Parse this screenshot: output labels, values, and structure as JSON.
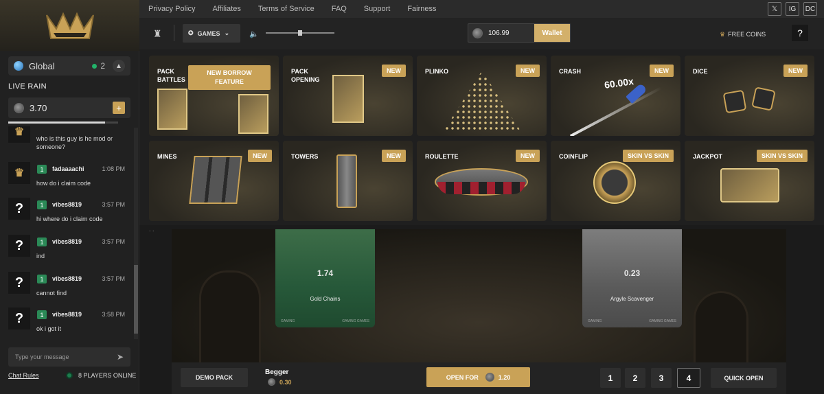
{
  "nav": {
    "links": [
      "Privacy Policy",
      "Affiliates",
      "Terms of Service",
      "FAQ",
      "Support",
      "Fairness"
    ],
    "social": [
      "𝕏",
      "IG",
      "DC"
    ]
  },
  "sidebar": {
    "room": {
      "name": "Global",
      "online_count": "2"
    },
    "live_rain": {
      "label": "LIVE RAIN",
      "amount": "3.70",
      "plus": "+"
    },
    "messages": [
      {
        "level": "",
        "user": "",
        "time": "",
        "text": "who is this guy is he mod or someone?",
        "avatar": "crown"
      },
      {
        "level": "1",
        "user": "fadaaaachi",
        "time": "1:08 PM",
        "text": "how do i claim code",
        "avatar": "crown"
      },
      {
        "level": "1",
        "user": "vibes8819",
        "time": "3:57 PM",
        "text": "hi where do i claim code",
        "avatar": "?"
      },
      {
        "level": "1",
        "user": "vibes8819",
        "time": "3:57 PM",
        "text": "ind",
        "avatar": "?"
      },
      {
        "level": "1",
        "user": "vibes8819",
        "time": "3:57 PM",
        "text": "cannot find",
        "avatar": "?"
      },
      {
        "level": "1",
        "user": "vibes8819",
        "time": "3:58 PM",
        "text": "ok i got it",
        "avatar": "?"
      }
    ],
    "input_placeholder": "Type your message",
    "chat_rules": "Chat Rules",
    "players_online": "8 PLAYERS ONLINE"
  },
  "toolbar": {
    "games_label": "GAMES",
    "balance": "106.99",
    "wallet_label": "Wallet",
    "free_coins": "FREE COINS",
    "help": "?",
    "volume_level": 0.5
  },
  "games": [
    {
      "name": "PACK BATTLES",
      "badge": "NEW BORROW FEATURE"
    },
    {
      "name": "PACK OPENING",
      "badge": "NEW"
    },
    {
      "name": "PLINKO",
      "badge": "NEW"
    },
    {
      "name": "CRASH",
      "badge": "NEW",
      "extra": "60.00x"
    },
    {
      "name": "DICE",
      "badge": "NEW"
    },
    {
      "name": "MINES",
      "badge": "NEW"
    },
    {
      "name": "TOWERS",
      "badge": "NEW"
    },
    {
      "name": "ROULETTE",
      "badge": "NEW"
    },
    {
      "name": "COINFLIP",
      "badge": "SKIN VS SKIN"
    },
    {
      "name": "JACKPOT",
      "badge": "SKIN VS SKIN"
    }
  ],
  "stage": {
    "dots": ". .",
    "cards": [
      {
        "value": "1.74",
        "name": "Gold Chains",
        "footer_left": "GAMING",
        "footer_right": "GAMING GAMES"
      },
      {
        "value": "0.23",
        "name": "Argyle Scavenger",
        "footer_left": "GAMING",
        "footer_right": "GAMING GAMES"
      }
    ]
  },
  "bottom": {
    "demo_label": "DEMO PACK",
    "pack_name": "Begger",
    "pack_price": "0.30",
    "open_label": "OPEN FOR",
    "open_price": "1.20",
    "quantities": [
      "1",
      "2",
      "3",
      "4"
    ],
    "selected_qty": "4",
    "quick_open": "QUICK OPEN"
  }
}
